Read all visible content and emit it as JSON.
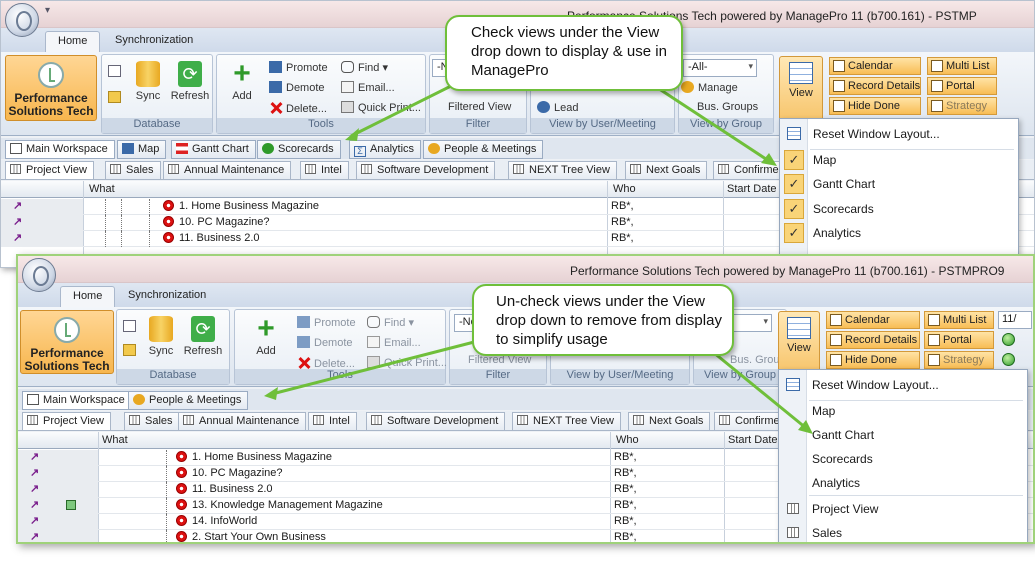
{
  "top": {
    "window_title": "Performance Solutions Tech powered by ManagePro 11 (b700.161) - PSTMP",
    "quick_access": "▾",
    "tabs": [
      "Home",
      "Synchronization"
    ],
    "brand_line1": "Performance",
    "brand_line2": "Solutions Tech",
    "groups": {
      "database": "Database",
      "tools": "Tools",
      "filter": "Filter",
      "view_by_user": "View by User/Meeting",
      "view_by_group": "View by Group"
    },
    "buttons": {
      "sync": "Sync",
      "refresh": "Refresh",
      "add": "Add",
      "promote": "Promote",
      "demote": "Demote",
      "delete": "Delete...",
      "find": "Find ▾",
      "email": "Email...",
      "quick_print": "Quick Print...",
      "filtered_view": "Filtered View",
      "lead": "Lead",
      "manage": "Manage",
      "bus_groups": "Bus. Groups",
      "view": "View"
    },
    "filter_value": "-N",
    "group_filter_value": "-All-",
    "view_buttons": {
      "calendar": "Calendar",
      "record_details": "Record Details",
      "hide_done": "Hide Done",
      "multi_list": "Multi List",
      "portal": "Portal",
      "strategy": "Strategy"
    },
    "workspace_tabs": [
      "Main Workspace",
      "Map",
      "Gantt Chart",
      "Scorecards",
      "Analytics",
      "People & Meetings"
    ],
    "view_tabs": [
      "Project View",
      "Sales",
      "Annual Maintenance",
      "Intel",
      "Software Development",
      "NEXT Tree View",
      "Next Goals",
      "Confirme"
    ],
    "grid_headers": {
      "what": "What",
      "who": "Who",
      "start": "Start Date"
    },
    "rows": [
      {
        "title": "1. Home Business Magazine",
        "who": "RB*,"
      },
      {
        "title": "10. PC Magazine?",
        "who": "RB*,"
      },
      {
        "title": "11. Business 2.0",
        "who": "RB*,"
      }
    ],
    "menu": {
      "reset": "Reset Window Layout...",
      "items": [
        {
          "label": "Map",
          "checked": true
        },
        {
          "label": "Gantt Chart",
          "checked": true
        },
        {
          "label": "Scorecards",
          "checked": true
        },
        {
          "label": "Analytics",
          "checked": true
        }
      ]
    },
    "callout": "Check views under the View drop down to display & use in ManagePro"
  },
  "bottom": {
    "window_title": "Performance Solutions Tech powered by ManagePro 11 (b700.161) - PSTMPRO9",
    "tabs": [
      "Home",
      "Synchronization"
    ],
    "brand_line1": "Performance",
    "brand_line2": "Solutions Tech",
    "groups": {
      "database": "Database",
      "tools": "Tools",
      "filter": "Filter",
      "view_by_user": "View by User/Meeting",
      "view_by_group": "View by Group"
    },
    "buttons": {
      "sync": "Sync",
      "refresh": "Refresh",
      "add": "Add",
      "promote": "Promote",
      "demote": "Demote",
      "delete": "Delete...",
      "find": "Find ▾",
      "email": "Email...",
      "quick_print": "Quick Print...",
      "filtered_view": "Filtered View",
      "bus_groups": "Bus. Groups",
      "view": "View"
    },
    "filter_value": "-None-",
    "date_value": "11/",
    "view_buttons": {
      "calendar": "Calendar",
      "record_details": "Record Details",
      "hide_done": "Hide Done",
      "multi_list": "Multi List",
      "portal": "Portal",
      "strategy": "Strategy"
    },
    "workspace_tabs": [
      "Main Workspace",
      "People & Meetings"
    ],
    "view_tabs": [
      "Project View",
      "Sales",
      "Annual Maintenance",
      "Intel",
      "Software Development",
      "NEXT Tree View",
      "Next Goals",
      "Confirme"
    ],
    "grid_headers": {
      "what": "What",
      "who": "Who",
      "start": "Start Date"
    },
    "rows": [
      {
        "title": "1. Home Business Magazine",
        "who": "RB*,"
      },
      {
        "title": "10. PC Magazine?",
        "who": "RB*,"
      },
      {
        "title": "11. Business 2.0",
        "who": "RB*,"
      },
      {
        "title": "13. Knowledge Management Magazine",
        "who": "RB*,"
      },
      {
        "title": "14.  InfoWorld",
        "who": "RB*,"
      },
      {
        "title": "2. Start Your Own Business",
        "who": "RB*,"
      }
    ],
    "menu": {
      "reset": "Reset Window Layout...",
      "items": [
        "Map",
        "Gantt Chart",
        "Scorecards",
        "Analytics"
      ],
      "view_items": [
        "Project View",
        "Sales"
      ]
    },
    "callout": "Un-check views under the View drop down to remove from display to simplify usage"
  },
  "colors": {
    "callout_border": "#6fbf3a",
    "arrow": "#6fbf3a",
    "ribbon_orange": "#f7b64e",
    "title_bar": "#e6d2d4"
  }
}
